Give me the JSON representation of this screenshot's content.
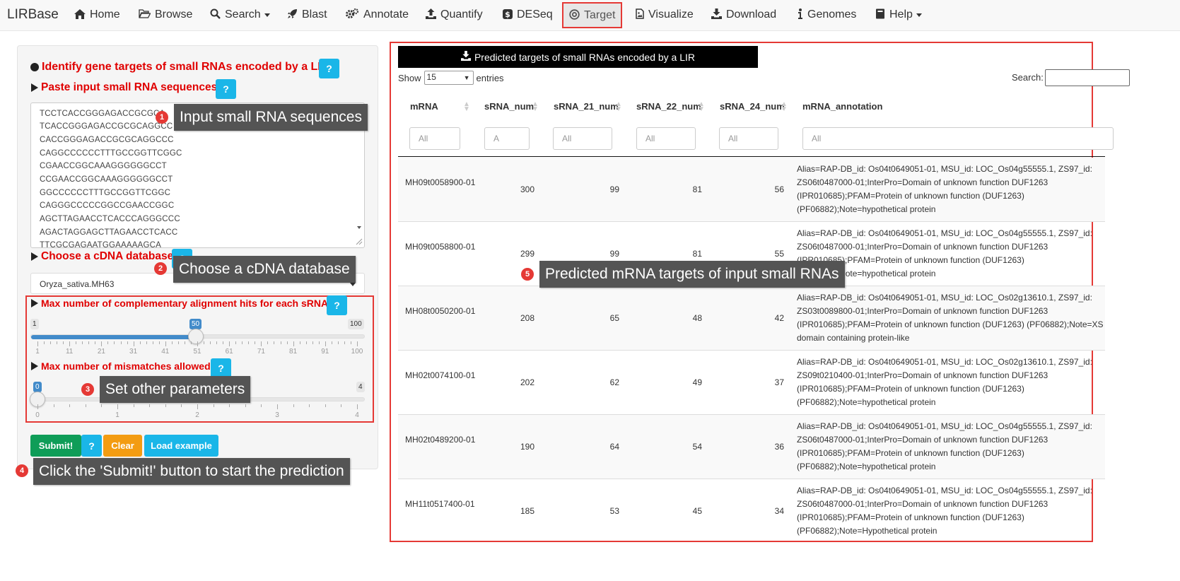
{
  "navbar": {
    "brand": "LIRBase",
    "items": [
      {
        "label": "Home",
        "icon": "home-icon"
      },
      {
        "label": "Browse",
        "icon": "folder-open-icon"
      },
      {
        "label": "Search",
        "icon": "search-icon"
      },
      {
        "label": "Blast",
        "icon": "rocket-icon"
      },
      {
        "label": "Annotate",
        "icon": "cogs-icon"
      },
      {
        "label": "Quantify",
        "icon": "upload-icon"
      },
      {
        "label": "DESeq",
        "icon": "dollar-icon"
      },
      {
        "label": "Target",
        "icon": "target-icon"
      },
      {
        "label": "Visualize",
        "icon": "file-image-icon"
      },
      {
        "label": "Download",
        "icon": "download-icon"
      },
      {
        "label": "Genomes",
        "icon": "info-icon"
      },
      {
        "label": "Help",
        "icon": "book-icon"
      }
    ],
    "active": "Target"
  },
  "form": {
    "title": "Identify gene targets of small RNAs encoded by a LIR",
    "paste_label": "Paste input small RNA sequences",
    "sequences": [
      "TCCTCACCGGGAGACCGCGCA",
      "TCACCGGGAGACCGCGCAGGCC",
      "CACCGGGAGACCGCGCAGGCCC",
      "CAGGCCCCCCTTTGCCGGTTCGGC",
      "CGAACCGGCAAAGGGGGGCCT",
      "CCGAACCGGCAAAGGGGGGCCT",
      "GGCCCCCCTTTGCCGGTTCGGC",
      "CAGGGCCCCCGGCCGAACCGGC",
      "AGCTTAGAACCTCACCCAGGGCCC",
      "AGACTAGGAGCTTAGAACCTCACC",
      "TTCGCGAGAATGGAAAAAGCA"
    ],
    "db_label": "Choose a cDNA database",
    "db_value": "Oryza_sativa.MH63",
    "hits_label": "Max number of complementary alignment hits for each sRNA",
    "hits_min": "1",
    "hits_max": "100",
    "hits_value": "50",
    "hits_ticks": [
      "1",
      "11",
      "21",
      "31",
      "41",
      "51",
      "61",
      "71",
      "81",
      "91",
      "100"
    ],
    "mismatch_label": "Max number of mismatches allowed",
    "mismatch_min": "0",
    "mismatch_max": "4",
    "mismatch_value": "0",
    "mismatch_ticks": [
      "0",
      "1",
      "2",
      "3",
      "4"
    ],
    "help_text": "?",
    "submit_label": "Submit!",
    "clear_label": "Clear",
    "example_label": "Load example"
  },
  "callouts": [
    {
      "num": "1",
      "text": "Input small RNA sequences"
    },
    {
      "num": "2",
      "text": "Choose a cDNA database"
    },
    {
      "num": "3",
      "text": "Set other parameters"
    },
    {
      "num": "4",
      "text": "Click the 'Submit!' button to start the prediction"
    },
    {
      "num": "5",
      "text": "Predicted mRNA targets of input small RNAs"
    }
  ],
  "results": {
    "download_label": "Predicted targets of small RNAs encoded by a LIR",
    "show_label": "Show",
    "page_length": "15",
    "entries_label": "entries",
    "search_label": "Search:",
    "columns": [
      "mRNA",
      "sRNA_num",
      "sRNA_21_num",
      "sRNA_22_num",
      "sRNA_24_num",
      "mRNA_annotation"
    ],
    "filters": [
      "All",
      "A",
      "All",
      "All",
      "All",
      "All"
    ],
    "rows": [
      {
        "mrna": "MH09t0058900-01",
        "srna": "300",
        "s21": "99",
        "s22": "81",
        "s24": "56",
        "annotation": "Alias=RAP-DB_id: Os04t0649051-01, MSU_id: LOC_Os04g55555.1, ZS97_id: ZS06t0487000-01;InterPro=Domain of unknown function DUF1263 (IPR010685);PFAM=Protein of unknown function (DUF1263) (PF06882);Note=hypothetical protein"
      },
      {
        "mrna": "MH09t0058800-01",
        "srna": "299",
        "s21": "99",
        "s22": "81",
        "s24": "55",
        "annotation": "Alias=RAP-DB_id: Os04t0649051-01, MSU_id: LOC_Os04g55555.1, ZS97_id: ZS06t0487000-01;InterPro=Domain of unknown function DUF1263 (IPR010685);PFAM=Protein of unknown function (DUF1263) (PF06882);Note=hypothetical protein"
      },
      {
        "mrna": "MH08t0050200-01",
        "srna": "208",
        "s21": "65",
        "s22": "48",
        "s24": "42",
        "annotation": "Alias=RAP-DB_id: Os04t0649051-01, MSU_id: LOC_Os02g13610.1, ZS97_id: ZS03t0089800-01;InterPro=Domain of unknown function DUF1263 (IPR010685);PFAM=Protein of unknown function (DUF1263) (PF06882);Note=XS domain containing protein-like"
      },
      {
        "mrna": "MH02t0074100-01",
        "srna": "202",
        "s21": "62",
        "s22": "49",
        "s24": "37",
        "annotation": "Alias=RAP-DB_id: Os04t0649051-01, MSU_id: LOC_Os02g13610.1, ZS97_id: ZS09t0210400-01;InterPro=Domain of unknown function DUF1263 (IPR010685);PFAM=Protein of unknown function (DUF1263) (PF06882);Note=hypothetical protein"
      },
      {
        "mrna": "MH02t0489200-01",
        "srna": "190",
        "s21": "64",
        "s22": "54",
        "s24": "36",
        "annotation": "Alias=RAP-DB_id: Os04t0649051-01, MSU_id: LOC_Os04g55555.1, ZS97_id: ZS06t0487000-01;InterPro=Domain of unknown function DUF1263 (IPR010685);PFAM=Protein of unknown function (DUF1263) (PF06882);Note=hypothetical protein"
      },
      {
        "mrna": "MH11t0517400-01",
        "srna": "185",
        "s21": "53",
        "s22": "45",
        "s24": "34",
        "annotation": "Alias=RAP-DB_id: Os04t0649051-01, MSU_id: LOC_Os04g55555.1, ZS97_id: ZS06t0487000-01;InterPro=Domain of unknown function DUF1263 (IPR010685);PFAM=Protein of unknown function (DUF1263) (PF06882);Note=Hypothetical protein"
      }
    ]
  },
  "colors": {
    "accent_red": "#e00000",
    "highlight_border": "#e53935",
    "help_blue": "#1ab6e8",
    "submit_green": "#0f9d58",
    "clear_orange": "#f39c12",
    "slider_blue": "#428bca",
    "callout_gray": "#545454"
  }
}
